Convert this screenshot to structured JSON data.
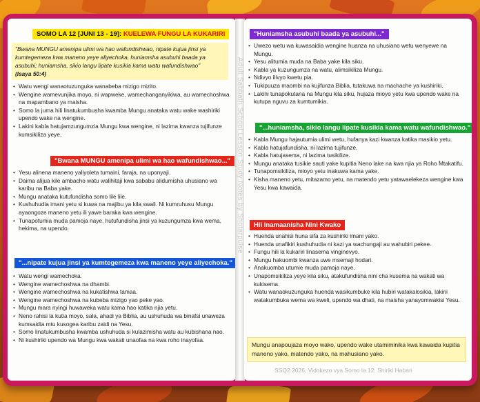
{
  "leftPage": {
    "lessonHeader": {
      "prefix": "SOMO LA 12 [JUNI 13 - 19]:",
      "title": "KUELEWA FUNGU LA KUKARIRI"
    },
    "memoryVerse": {
      "text": "\"Bwana MUNGU amenipa ulimi wa hao wafundishwao, nipate kujua jinsi ya kumtegemeza kwa maneno yeye aliyechoka, huniamsha asubuhi baada ya asubuhi; huniamsha, sikio langu lipate kusikia kama watu wafundishwao\"",
      "reference": "(Isaya 50:4)"
    },
    "introBullets": [
      "Watu wengi wanaotuzunguka wanabeba mizigo mizito.",
      "Wengine wamevunjika moyo, ni wapweke, wamechanganyikiwa, au wamechoshwa na mapambano ya maisha.",
      "Somo la juma hili linatukumbusha kwamba Mungu anataka watu wake washiriki upendo wake na wengine.",
      "Lakini kabla hatujamzungumzia Mungu kwa wengine, ni lazima kwanza tujifunze kumsikiliza yeye."
    ],
    "section1": {
      "header": "\"Bwana MUNGU amenipa ulimi wa hao wafundishwao...\"",
      "bullets": [
        "Yesu alinena maneno yaliyoleta tumaini, faraja, na uponyaji.",
        "Daima alijua kile ambacho watu walihitaji kwa sababu alidumisha uhusiano wa karibu na Baba yake.",
        "Mungu anataka kutufundisha somo lile lile.",
        "Kushuhudia imani yetu si kuwa na majibu ya kila swali. Ni kumruhusu Mungu ayaongoze maneno yetu ili yawe baraka kwa wengine.",
        "Tunapotumia muda pamoja naye, hutufundisha jinsi ya kuzungumza kwa wema, hekima, na upendo."
      ]
    },
    "section2": {
      "header": "\"...nipate kujua jinsi ya kumtegemeza kwa maneno yeye aliyechoka.\"",
      "bullets": [
        "Watu wengi wamechoka.",
        "Wengine wamechoshwa na dhambi.",
        "Wengine wamechoshwa na kukatishwa tamaa.",
        "Wengine wamechoshwa na kubeba mizigo yao peke yao.",
        "Mungu mara nyingi huwaweka watu kama hao katika njia yetu.",
        "Neno rahisi la kutia moyo, sala, ahadi ya Biblia, au ushuhuda wa binafsi unaweza kumsaidia mtu kusogea karibu zaidi na Yesu.",
        "Somo linatukumbusha kwamba ushuhuda si kulazimisha watu au kubishana nao.",
        "Ni kushiriki upendo wa Mungu kwa wakati unaofaa na kwa roho inayofaa."
      ]
    }
  },
  "rightPage": {
    "section3": {
      "header": "\"Huniamsha asubuhi baada ya asubuhi...\"",
      "bullets": [
        "Uwezo wetu wa kuwasaidia wengine huanza na uhusiano wetu wenyewe na Mungu.",
        "Yesu alitumia muda na Baba yake kila siku.",
        "Kabla ya kuzungumza na watu, alimsikiliza Mungu.",
        "Ndivyo ilivyo kwetu pia.",
        "Tukipuuza maombi na kujifunza Biblia, tutakuwa na machache ya kushiriki.",
        "Lakini tunapokutana na Mungu kila siku, hujaza mioyo yetu kwa upendo wake na kutupa nguvu za kumtumikia."
      ]
    },
    "section4": {
      "header": "\"...huniamsha, sikio langu lipate kusikia kama watu wafundishwao.\"",
      "bullets": [
        "Kabla Mungu hajautumia ulimi wetu, hufanya kazi kwanza katika masikio yetu.",
        "Kabla hatujafundisha, ni lazima tujifunze.",
        "Kabla hatujasema, ni lazima tusikilize.",
        "Mungu anataka tusikie sauti yake kupitia Neno lake na kwa njia ya Roho Mtakatifu.",
        "Tunapomsikiliza, mioyo yetu inakuwa kama yake.",
        "Kisha maneno yetu, mitazamo yetu, na matendo yetu yatawaelekeza wengine kwa Yesu kwa kawaida."
      ]
    },
    "section5": {
      "header": "Hii Inamaanisha Nini Kwako",
      "bullets": [
        "Huenda unahisi huna sifa za kushiriki imani yako.",
        "Huenda unafikiri kushuhudia ni kazi ya wachungaji au wahubiri pekee.",
        "Fungu hili la kukariri linasema vinginevyo.",
        "Mungu hakuombi kwanza uwe msemaji hodari.",
        "Anakuomba utumie muda pamoja naye.",
        "Unapomsikiliza yeye kila siku, atakufundisha nini cha kusema na wakati wa kukisema.",
        "Watu wanaokuzunguka huenda wasikumbuke kila hubiri watakalosikia, lakini watakumbuka wema wa kweli, upendo wa dhati, na maisha yanayomwakisi Yesu."
      ]
    },
    "closing": "Mungu anapoujaza moyo wako, upendo wake utamiminika kwa kawaida kupitia maneno yako, matendo yako, na mahusiano yako.",
    "footer": "SSQ2 2026, Vidokezo vya Somo la 12: Shiriki Habari"
  },
  "watermark": "Adult Sabbath School Lesson Study Notes by Shotarpulse",
  "colors": {
    "cover": "#c8195e",
    "background": "#e0761e",
    "headerYellow": "#ffe600",
    "headerPurple": "#7d2ad0",
    "headerGreen": "#18a334",
    "headerRed": "#e3251b",
    "headerBlue": "#1556d8",
    "quoteBg": "#fff6b8"
  }
}
